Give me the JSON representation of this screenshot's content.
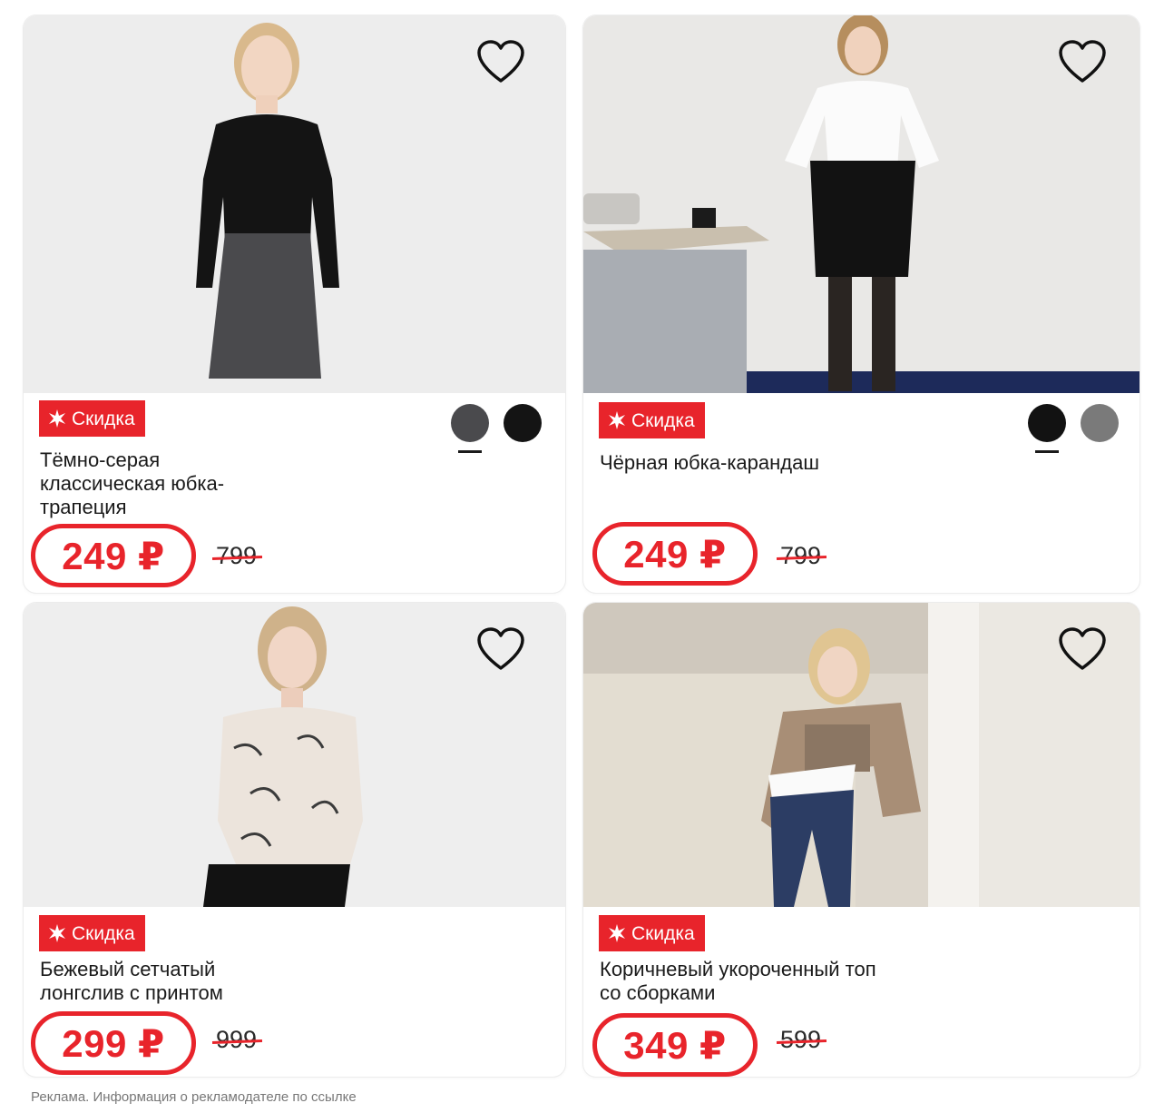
{
  "products": [
    {
      "badge": "Скидка",
      "title": "Тёмно-серая классическая юбка-трапеция",
      "price": "249 ₽",
      "old_price": "799",
      "swatches": [
        "#4a4a4d",
        "#141414"
      ],
      "selected_swatch": 0
    },
    {
      "badge": "Скидка",
      "title": "Чёрная юбка-карандаш",
      "price": "249 ₽",
      "old_price": "799",
      "swatches": [
        "#121212",
        "#7a7a7a"
      ],
      "selected_swatch": 0
    },
    {
      "badge": "Скидка",
      "title": "Бежевый сетчатый лонгслив с принтом",
      "price": "299 ₽",
      "old_price": "999"
    },
    {
      "badge": "Скидка",
      "title": "Коричневый укороченный топ со сборками",
      "price": "349 ₽",
      "old_price": "599"
    }
  ],
  "colors": {
    "accent": "#e8242b",
    "card_bg": "#ffffff",
    "photo_bg": "#ededed"
  },
  "icons": {
    "favorite": "heart-outline-icon",
    "badge": "burst-star-icon"
  },
  "footer": {
    "disclaimer": "Реклама. Информация о рекламодателе по ссылке"
  }
}
